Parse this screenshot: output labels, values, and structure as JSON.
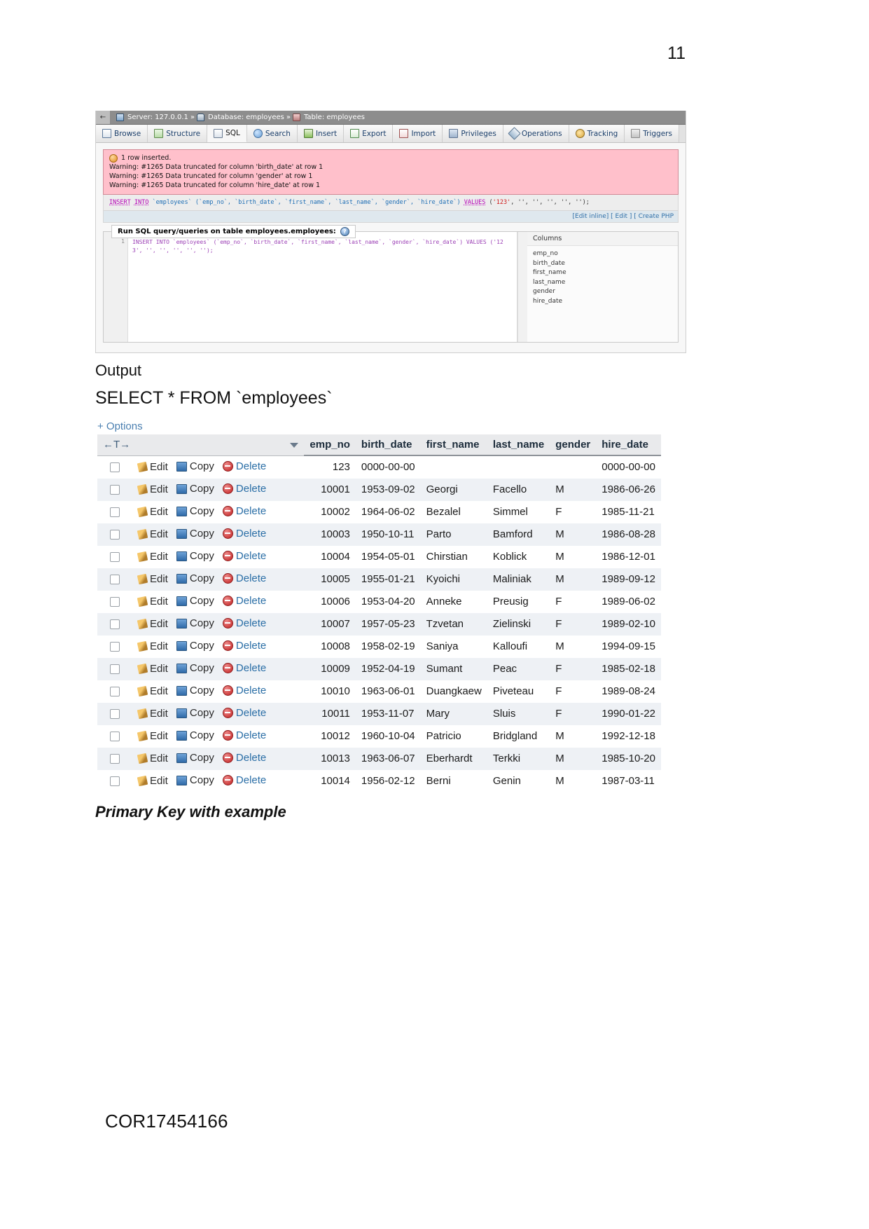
{
  "page": {
    "number": "11",
    "footer_code": "COR17454166"
  },
  "pma": {
    "breadcrumb": {
      "back": "←",
      "server_label": "Server: 127.0.0.1",
      "sep1": "»",
      "database_label": "Database: employees",
      "sep2": "»",
      "table_label": "Table: employees"
    },
    "tabs": [
      {
        "label": "Browse",
        "icon": "browse-icon",
        "active": false
      },
      {
        "label": "Structure",
        "icon": "structure-icon",
        "active": false
      },
      {
        "label": "SQL",
        "icon": "sql-icon",
        "active": true
      },
      {
        "label": "Search",
        "icon": "search-icon",
        "active": false
      },
      {
        "label": "Insert",
        "icon": "insert-icon",
        "active": false
      },
      {
        "label": "Export",
        "icon": "export-icon",
        "active": false
      },
      {
        "label": "Import",
        "icon": "import-icon",
        "active": false
      },
      {
        "label": "Privileges",
        "icon": "privileges-icon",
        "active": false
      },
      {
        "label": "Operations",
        "icon": "operations-icon",
        "active": false
      },
      {
        "label": "Tracking",
        "icon": "tracking-icon",
        "active": false
      },
      {
        "label": "Triggers",
        "icon": "triggers-icon",
        "active": false
      }
    ],
    "message": {
      "status": "1 row inserted.",
      "warning_1": "Warning: #1265 Data truncated for column 'birth_date' at row 1",
      "warning_2": "Warning: #1265 Data truncated for column 'gender' at row 1",
      "warning_3": "Warning: #1265 Data truncated for column 'hire_date' at row 1"
    },
    "executed_sql": {
      "kw_insert": "INSERT",
      "kw_into": "INTO",
      "target": "`employees`",
      "columns": "(`emp_no`, `birth_date`, `first_name`, `last_name`, `gender`, `hire_date`)",
      "kw_values": "VALUES",
      "values_open": "(",
      "value_num": "'123'",
      "values_rest": ", '', '', '', '', '');"
    },
    "action_links": {
      "edit_inline": "[Edit inline]",
      "edit": "[ Edit ]",
      "create_php": "[ Create PHP"
    },
    "query_panel": {
      "legend": "Run SQL query/queries on table employees.employees:",
      "help_icon": "help-icon",
      "line_number": "1",
      "sql_text": "INSERT INTO `employees` (`emp_no`, `birth_date`, `first_name`, `last_name`, `gender`, `hire_date`) VALUES ('123', '', '', '', '', '');",
      "columns_header": "Columns",
      "columns": [
        "emp_no",
        "birth_date",
        "first_name",
        "last_name",
        "gender",
        "hire_date"
      ]
    },
    "colors": {
      "warning_bg": "#ffc0cb",
      "breadcrumb_bg": "#8d8d8d",
      "link": "#2f6fa8"
    }
  },
  "document": {
    "output_heading": "Output",
    "select_statement": "SELECT * FROM `employees`",
    "primary_key_heading": "Primary Key with example"
  },
  "results": {
    "options_label": "+ Options",
    "sort_control": "←T→",
    "actions": {
      "edit": "Edit",
      "copy": "Copy",
      "delete": "Delete"
    },
    "columns": [
      "emp_no",
      "birth_date",
      "first_name",
      "last_name",
      "gender",
      "hire_date"
    ],
    "rows": [
      {
        "emp_no": "123",
        "birth_date": "0000-00-00",
        "first_name": "",
        "last_name": "",
        "gender": "",
        "hire_date": "0000-00-00"
      },
      {
        "emp_no": "10001",
        "birth_date": "1953-09-02",
        "first_name": "Georgi",
        "last_name": "Facello",
        "gender": "M",
        "hire_date": "1986-06-26"
      },
      {
        "emp_no": "10002",
        "birth_date": "1964-06-02",
        "first_name": "Bezalel",
        "last_name": "Simmel",
        "gender": "F",
        "hire_date": "1985-11-21"
      },
      {
        "emp_no": "10003",
        "birth_date": "1950-10-11",
        "first_name": "Parto",
        "last_name": "Bamford",
        "gender": "M",
        "hire_date": "1986-08-28"
      },
      {
        "emp_no": "10004",
        "birth_date": "1954-05-01",
        "first_name": "Chirstian",
        "last_name": "Koblick",
        "gender": "M",
        "hire_date": "1986-12-01"
      },
      {
        "emp_no": "10005",
        "birth_date": "1955-01-21",
        "first_name": "Kyoichi",
        "last_name": "Maliniak",
        "gender": "M",
        "hire_date": "1989-09-12"
      },
      {
        "emp_no": "10006",
        "birth_date": "1953-04-20",
        "first_name": "Anneke",
        "last_name": "Preusig",
        "gender": "F",
        "hire_date": "1989-06-02"
      },
      {
        "emp_no": "10007",
        "birth_date": "1957-05-23",
        "first_name": "Tzvetan",
        "last_name": "Zielinski",
        "gender": "F",
        "hire_date": "1989-02-10"
      },
      {
        "emp_no": "10008",
        "birth_date": "1958-02-19",
        "first_name": "Saniya",
        "last_name": "Kalloufi",
        "gender": "M",
        "hire_date": "1994-09-15"
      },
      {
        "emp_no": "10009",
        "birth_date": "1952-04-19",
        "first_name": "Sumant",
        "last_name": "Peac",
        "gender": "F",
        "hire_date": "1985-02-18"
      },
      {
        "emp_no": "10010",
        "birth_date": "1963-06-01",
        "first_name": "Duangkaew",
        "last_name": "Piveteau",
        "gender": "F",
        "hire_date": "1989-08-24"
      },
      {
        "emp_no": "10011",
        "birth_date": "1953-11-07",
        "first_name": "Mary",
        "last_name": "Sluis",
        "gender": "F",
        "hire_date": "1990-01-22"
      },
      {
        "emp_no": "10012",
        "birth_date": "1960-10-04",
        "first_name": "Patricio",
        "last_name": "Bridgland",
        "gender": "M",
        "hire_date": "1992-12-18"
      },
      {
        "emp_no": "10013",
        "birth_date": "1963-06-07",
        "first_name": "Eberhardt",
        "last_name": "Terkki",
        "gender": "M",
        "hire_date": "1985-10-20"
      },
      {
        "emp_no": "10014",
        "birth_date": "1956-02-12",
        "first_name": "Berni",
        "last_name": "Genin",
        "gender": "M",
        "hire_date": "1987-03-11"
      }
    ]
  }
}
